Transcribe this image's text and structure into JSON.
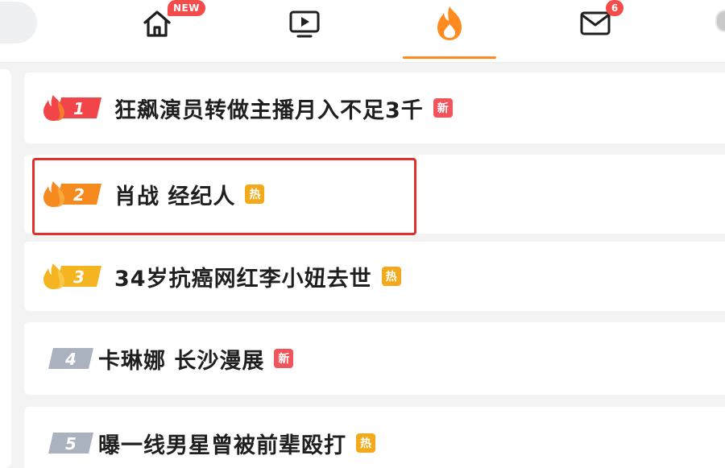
{
  "nav": {
    "home_icon": "home-icon",
    "home_badge": "NEW",
    "video_icon": "tv-play-icon",
    "hot_icon": "flame-icon",
    "message_icon": "mail-icon",
    "message_badge": "6",
    "active_tab": "hot",
    "accent_color": "#ff8a1f"
  },
  "hot_list": [
    {
      "rank": "1",
      "title": "狂飙演员转做主播月入不足3千",
      "tag": "新",
      "tag_type": "new",
      "flame": true
    },
    {
      "rank": "2",
      "title": "肖战 经纪人",
      "tag": "热",
      "tag_type": "hot",
      "flame": true
    },
    {
      "rank": "3",
      "title": "34岁抗癌网红李小妞去世",
      "tag": "热",
      "tag_type": "hot",
      "flame": true
    },
    {
      "rank": "4",
      "title": "卡琳娜 长沙漫展",
      "tag": "新",
      "tag_type": "new",
      "flame": false
    },
    {
      "rank": "5",
      "title": "曝一线男星曾被前辈殴打",
      "tag": "热",
      "tag_type": "hot",
      "flame": false
    }
  ],
  "colors": {
    "rank1": "#f2454a",
    "rank2": "#f58a1f",
    "rank3": "#f5b521",
    "rank_other": "#aab2c0",
    "highlight": "#e0302c"
  }
}
